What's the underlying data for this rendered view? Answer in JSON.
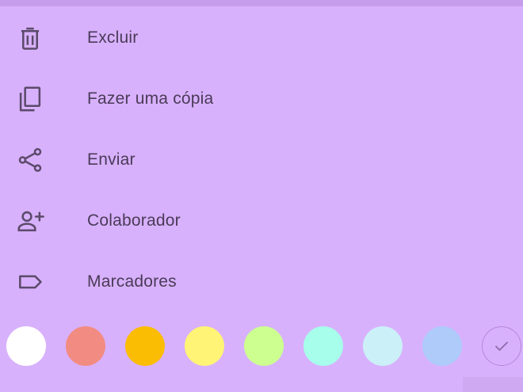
{
  "menu": {
    "items": [
      {
        "label": "Excluir",
        "icon": "trash-icon"
      },
      {
        "label": "Fazer uma cópia",
        "icon": "copy-icon"
      },
      {
        "label": "Enviar",
        "icon": "share-icon"
      },
      {
        "label": "Colaborador",
        "icon": "person-add-icon"
      },
      {
        "label": "Marcadores",
        "icon": "label-icon"
      }
    ]
  },
  "palette": {
    "colors": [
      {
        "name": "white",
        "hex": "#ffffff"
      },
      {
        "name": "red",
        "hex": "#f28b82"
      },
      {
        "name": "orange",
        "hex": "#fbbc04"
      },
      {
        "name": "yellow",
        "hex": "#fff475"
      },
      {
        "name": "green",
        "hex": "#ccff90"
      },
      {
        "name": "teal",
        "hex": "#a7ffeb"
      },
      {
        "name": "blue",
        "hex": "#cbf0f8"
      },
      {
        "name": "dark-blue",
        "hex": "#aecbfa"
      },
      {
        "name": "purple",
        "hex": "#d7aefb",
        "selected": true
      }
    ]
  },
  "theme": {
    "background": "#d8b1fc",
    "text": "#4a3b58",
    "icon": "#5b4a6a"
  }
}
